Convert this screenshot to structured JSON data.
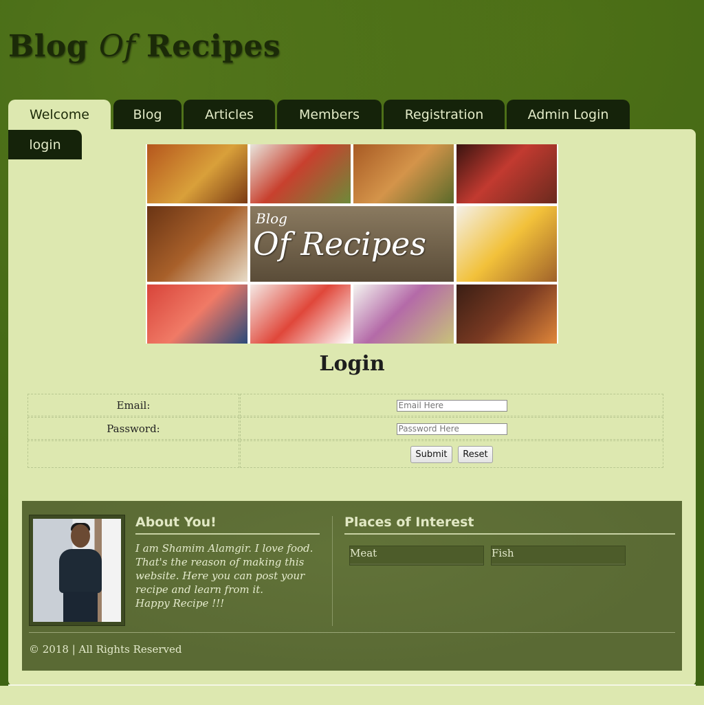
{
  "site": {
    "title_pre": "Blog",
    "title_of": "Of",
    "title_post": "Recipes"
  },
  "nav": {
    "tabs": [
      {
        "label": "Welcome"
      },
      {
        "label": "Blog"
      },
      {
        "label": "Articles"
      },
      {
        "label": "Members"
      },
      {
        "label": "Registration"
      },
      {
        "label": "Admin Login"
      },
      {
        "label": "login"
      }
    ]
  },
  "banner": {
    "blog_word": "Blog",
    "main_word": "Of Recipes"
  },
  "login": {
    "title": "Login",
    "email_label": "Email:",
    "email_placeholder": "Email Here",
    "password_label": "Password:",
    "password_placeholder": "Password Here",
    "submit_label": "Submit",
    "reset_label": "Reset"
  },
  "footer": {
    "about_title": "About You!",
    "about_lines": [
      "I am Shamim Alamgir. I love food.",
      "That's the reason of making this",
      "website. Here you can post your",
      "recipe and learn from it.",
      "Happy Recipe !!!"
    ],
    "places_title": "Places of Interest",
    "places": [
      "Meat",
      "Fish"
    ],
    "copyright": "© 2018 | All Rights Reserved"
  }
}
